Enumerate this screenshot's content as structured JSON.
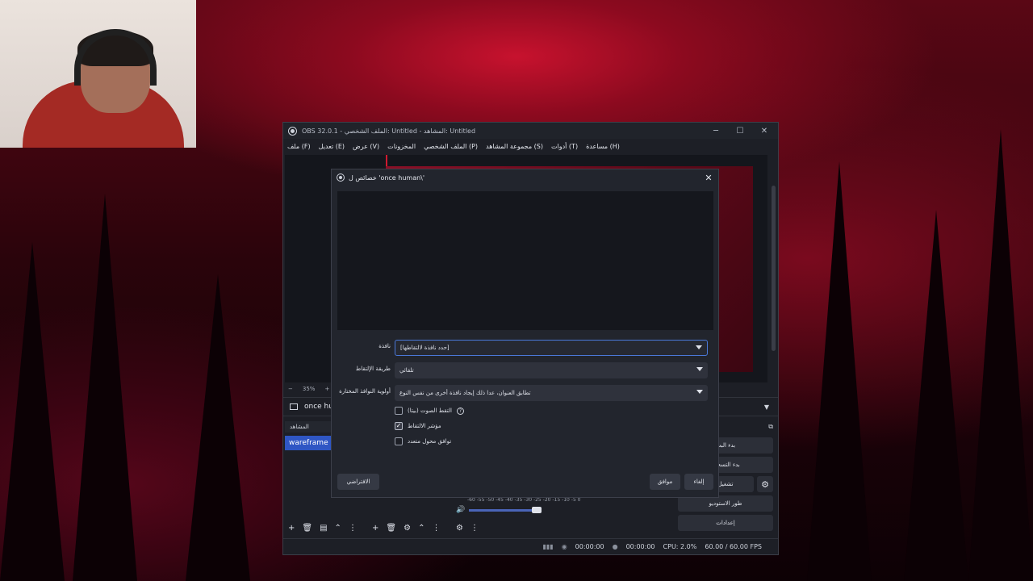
{
  "obs": {
    "title": "OBS 32.0.1 - الملف الشخصي: Untitled - المشاهد: Untitled",
    "window_controls": {
      "minimize": "─",
      "maximize": "☐",
      "close": "✕"
    },
    "menu": [
      "ملف (F)",
      "تعديل (E)",
      "عرض (V)",
      "المخزونات",
      "الملف الشخصي (P)",
      "مجموعة المشاهد (S)",
      "أدوات (T)",
      "مساعدة (H)"
    ],
    "zoom": {
      "minus": "−",
      "value": "35%",
      "plus": "+"
    },
    "source_name": "once hu",
    "scenes": {
      "header": "المشاهد",
      "items": [
        "wareframe"
      ]
    },
    "controls": {
      "start_streaming": "بدء البث",
      "start_recording": "بدء التسجيل",
      "virtual_camera": "تشغيل الكاميرا",
      "studio_mode": "طور الاستوديو",
      "settings": "إعدادات"
    },
    "mixer": {
      "ticks": "-60 -55 -50 -45 -40 -35 -30 -25 -20 -15 -10 -5 0"
    },
    "status": {
      "rec_time": "00:00:00",
      "stream_time": "00:00:00",
      "cpu": "CPU: 2.0%",
      "fps": "60.00 / 60.00 FPS"
    }
  },
  "dialog": {
    "title": "خصائص ل 'once human\\'",
    "close": "✕",
    "fields": {
      "window_label": "نافذة",
      "window_value": "[حدد نافذة لالتقاطها]",
      "method_label": "طريقة الإلتقاط",
      "method_value": "تلقائي",
      "priority_label": "أولوية النوافذ المختارة",
      "priority_value": "تطابق العنوان، عدا ذلك إيجاد نافذة أخرى من نفس النوع"
    },
    "checks": [
      {
        "label": "التقط الصوت (بيتا)",
        "checked": false
      },
      {
        "label": "مؤشر الالتقاط",
        "checked": true
      },
      {
        "label": "توافق محول متعدد",
        "checked": false
      }
    ],
    "buttons": {
      "defaults": "الافتراضي",
      "ok": "موافق",
      "cancel": "إلغاء"
    }
  }
}
